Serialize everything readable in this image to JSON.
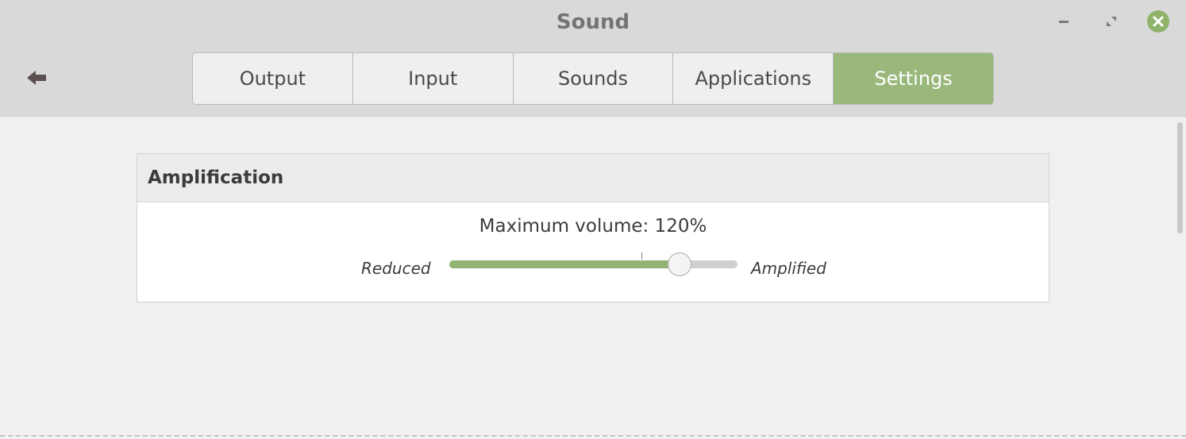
{
  "window": {
    "title": "Sound"
  },
  "colors": {
    "accent": "#9ab87c",
    "header_bg": "#d9d9d9",
    "close_button": "#8fb36a"
  },
  "icons": {
    "back": "back-arrow-icon",
    "minimize": "minimize-icon",
    "maximize": "maximize-icon",
    "close": "close-icon"
  },
  "tabs": [
    {
      "label": "Output",
      "active": false
    },
    {
      "label": "Input",
      "active": false
    },
    {
      "label": "Sounds",
      "active": false
    },
    {
      "label": "Applications",
      "active": false
    },
    {
      "label": "Settings",
      "active": true
    }
  ],
  "amplification": {
    "section_title": "Amplification",
    "volume_label": "Maximum volume: 120%",
    "min_label": "Reduced",
    "max_label": "Amplified",
    "slider": {
      "value_percent": 120,
      "min_percent": 0,
      "max_percent": 150,
      "mark_percent": 100
    }
  }
}
